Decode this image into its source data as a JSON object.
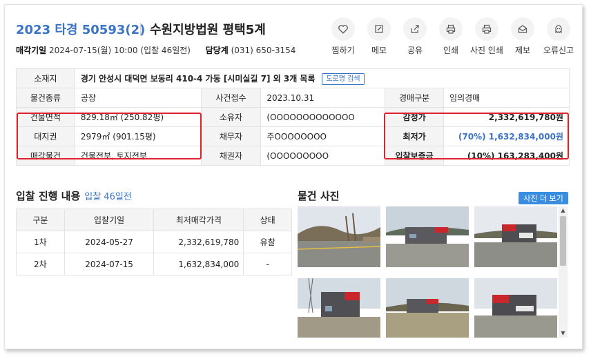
{
  "header": {
    "case_no": "2023 타경 50593(2)",
    "court": "수원지방법원 평택5계",
    "sale_date_label": "매각기일",
    "sale_date_value": "2024-07-15(월) 10:00 (입찰 46일전)",
    "dept_label": "담당계",
    "dept_value": "(031) 650-3154"
  },
  "actions": [
    {
      "label": "찜하기",
      "icon": "heart-icon"
    },
    {
      "label": "메모",
      "icon": "memo-icon"
    },
    {
      "label": "공유",
      "icon": "share-icon"
    },
    {
      "label": "인쇄",
      "icon": "print-icon"
    },
    {
      "label": "사진 인쇄",
      "icon": "photo-print-icon"
    },
    {
      "label": "제보",
      "icon": "report-icon"
    },
    {
      "label": "오류신고",
      "icon": "ghost-icon"
    }
  ],
  "info": {
    "location_label": "소재지",
    "location_value": "경기 안성시 대덕면 보동리 410-4 가동 [시미실길 7] 외 3개 목록",
    "road_btn": "도로명 검색",
    "type_label": "물건종류",
    "type_value": "공장",
    "filed_label": "사건접수",
    "filed_value": "2023.10.31",
    "sale_type_label": "경매구분",
    "sale_type_value": "임의경매",
    "bldg_area_label": "건물면적",
    "bldg_area_value": "829.18㎡ (250.82평)",
    "owner_label": "소유자",
    "owner_value": "(OOOOOOOOOOOOO",
    "appraisal_label": "감정가",
    "appraisal_value": "2,332,619,780원",
    "land_label": "대지권",
    "land_value": "2979㎡ (901.15평)",
    "debtor_label": "채무자",
    "debtor_value": "주OOOOOOOO",
    "min_label": "최저가",
    "min_value": "(70%) 1,632,834,000원",
    "object_label": "매각물건",
    "object_value": "건물전부, 토지전부",
    "creditor_label": "채권자",
    "creditor_value": "(OOOOOOOOO",
    "deposit_label": "입찰보증금",
    "deposit_value": "(10%) 163,283,400원"
  },
  "bids": {
    "title": "입찰 진행 내용",
    "sub": "입찰 46일전",
    "headers": [
      "구분",
      "입찰기일",
      "최저매각가격",
      "상태"
    ],
    "rows": [
      [
        "1차",
        "2024-05-27",
        "2,332,619,780",
        "유찰"
      ],
      [
        "2차",
        "2024-07-15",
        "1,632,834,000",
        "-"
      ]
    ]
  },
  "photos": {
    "title": "물건 사진",
    "more_btn": "사진 더 보기"
  },
  "colors": {
    "accent": "#3b74c7",
    "highlight": "#e0202a",
    "button": "#3b8de0"
  }
}
